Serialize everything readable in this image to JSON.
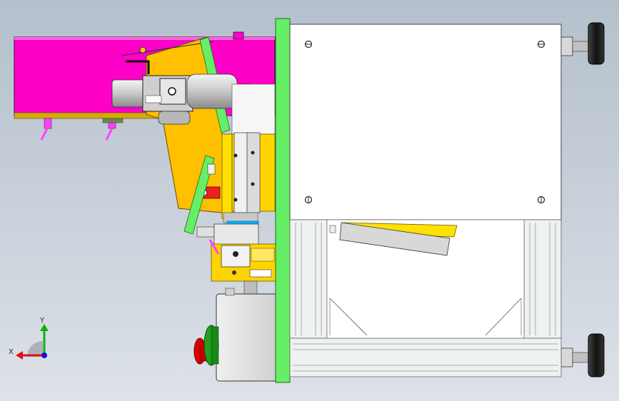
{
  "viewport": {
    "background_top": "#b4c0cc",
    "background_bottom": "#dde2e8"
  },
  "triad": {
    "x_label": "X",
    "y_label": "Y",
    "x_color": "#e01010",
    "y_color": "#10b010",
    "z_color": "#1010d0"
  },
  "model": {
    "colors": {
      "housing_magenta": "#ff00c8",
      "bracket_yellow": "#ffc000",
      "frame_green": "#66ee66",
      "panel_white": "#ffffff",
      "extrusion_gray": "#e8eef0",
      "motor_gray": "#d8d8d8",
      "stop_button_red": "#e00000",
      "start_button_green": "#20a020",
      "foot_black": "#1a1a1a"
    }
  }
}
